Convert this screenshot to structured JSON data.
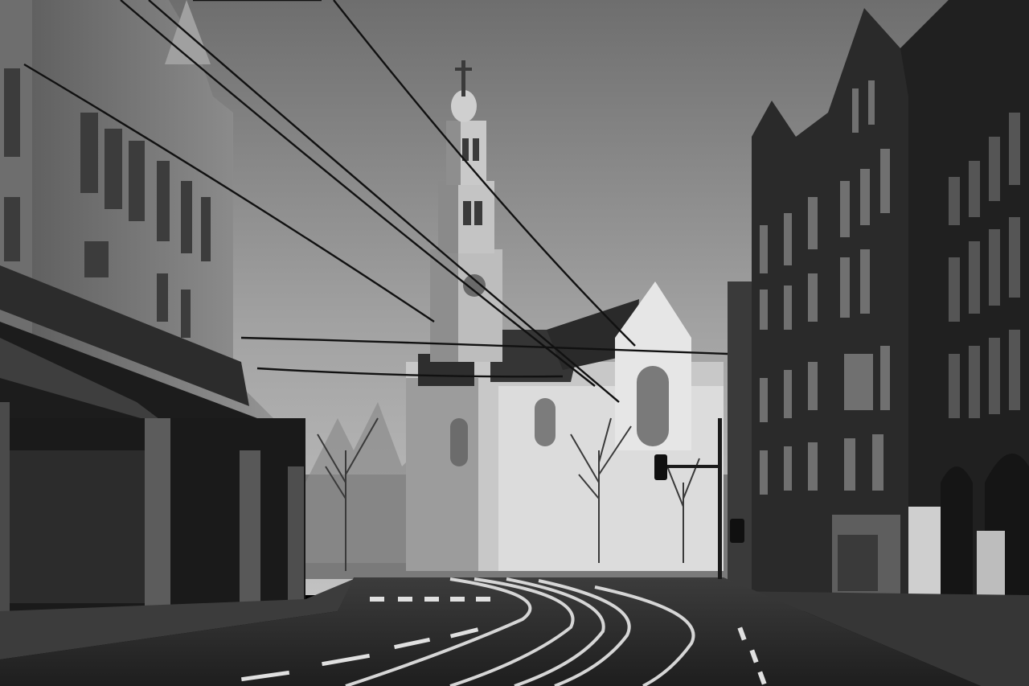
{
  "scene": {
    "palette": {
      "sky_top": "#6a6a6a",
      "sky_bottom": "#b4b4b4",
      "road": "#2a2a2a",
      "sidewalk": "#3a3a3a",
      "building_dark": "#262626",
      "building_mid": "#4a4a4a",
      "church_light": "#d8d8d8",
      "church_shadow": "#8a8a8a",
      "roof_dark": "#2e2e2e",
      "line_white": "#e6e6e6",
      "wire": "#101010"
    }
  }
}
